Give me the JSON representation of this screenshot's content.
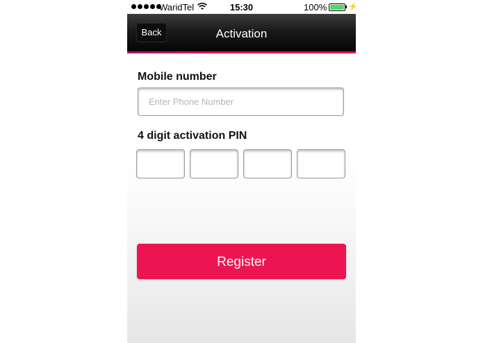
{
  "status_bar": {
    "signal_dots": 5,
    "carrier": "WaridTel",
    "wifi_icon": "wifi-icon",
    "time": "15:30",
    "battery_percent": "100%",
    "battery_level": 1.0,
    "battery_color": "#4cd964",
    "charging_icon": "bolt-icon"
  },
  "nav": {
    "back_label": "Back",
    "title": "Activation",
    "accent_colors": [
      "#a0187a",
      "#e8124e"
    ]
  },
  "form": {
    "mobile_label": "Mobile number",
    "mobile_placeholder": "Enter Phone Number",
    "mobile_value": "",
    "pin_label": "4 digit activation PIN",
    "pin_digits": [
      "",
      "",
      "",
      ""
    ]
  },
  "actions": {
    "register_label": "Register",
    "register_color": "#ec1552"
  }
}
